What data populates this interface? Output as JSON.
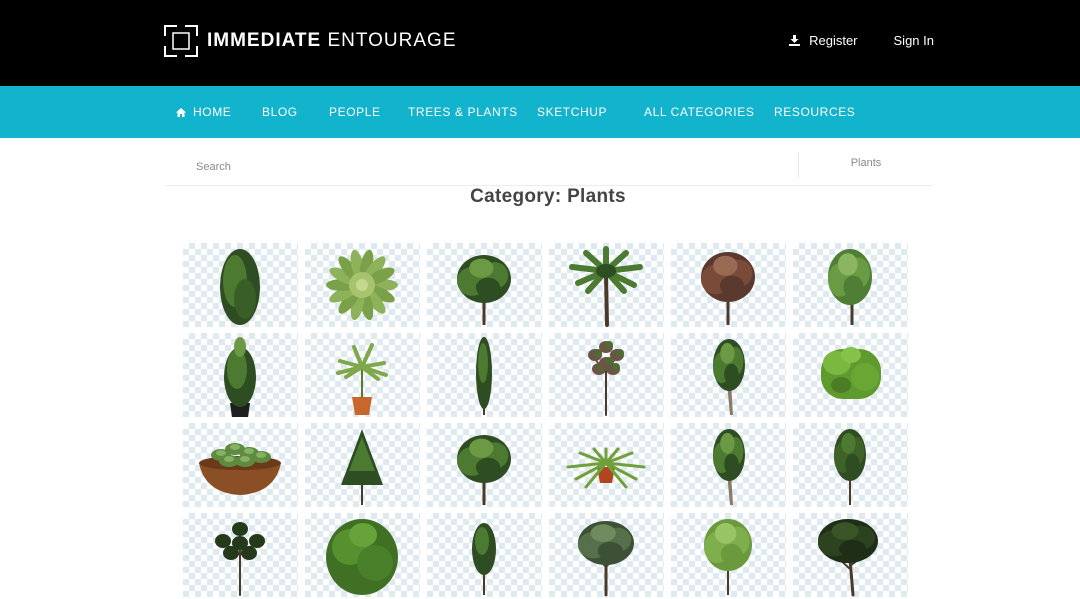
{
  "header": {
    "logo_text_bold": "IMMEDIATE",
    "logo_text_light": "ENTOURAGE",
    "register_label": "Register",
    "signin_label": "Sign In",
    "register_icon": "download-icon",
    "logo_icon": "bracket-square-logo"
  },
  "nav": {
    "home_icon": "home-icon",
    "items": [
      "HOME",
      "BLOG",
      "PEOPLE",
      "TREES & PLANTS",
      "SKETCHUP",
      "ALL CATEGORIES",
      "RESOURCES"
    ]
  },
  "search": {
    "placeholder": "Search",
    "category_value": "Plants"
  },
  "page_title": "Category: Plants",
  "colors": {
    "header_bg": "#000000",
    "nav_bg": "#12b3cd",
    "foliage_dark": "#2f4d22",
    "foliage_mid": "#4b7a30",
    "foliage_light": "#6c9a44",
    "trunk": "#4a3a2a",
    "pot_terracotta": "#c9662b",
    "pot_black": "#1e1e1e"
  },
  "tiles": [
    {
      "kind": "cypress-shrub"
    },
    {
      "kind": "succulent-rosette"
    },
    {
      "kind": "tree-round"
    },
    {
      "kind": "palm"
    },
    {
      "kind": "tree-autumn"
    },
    {
      "kind": "tree-light"
    },
    {
      "kind": "potted-cone"
    },
    {
      "kind": "potted-palm"
    },
    {
      "kind": "columnar-tree"
    },
    {
      "kind": "tree-sparse"
    },
    {
      "kind": "tree-slim"
    },
    {
      "kind": "hedge"
    },
    {
      "kind": "bowl-succulents"
    },
    {
      "kind": "conifer"
    },
    {
      "kind": "tree-round"
    },
    {
      "kind": "fern-pot"
    },
    {
      "kind": "tree-slim"
    },
    {
      "kind": "tree-thin"
    },
    {
      "kind": "tree-sparse-dark"
    },
    {
      "kind": "bush-round"
    },
    {
      "kind": "columnar-small"
    },
    {
      "kind": "olive-tree"
    },
    {
      "kind": "tree-light-round"
    },
    {
      "kind": "tree-gnarled"
    }
  ]
}
